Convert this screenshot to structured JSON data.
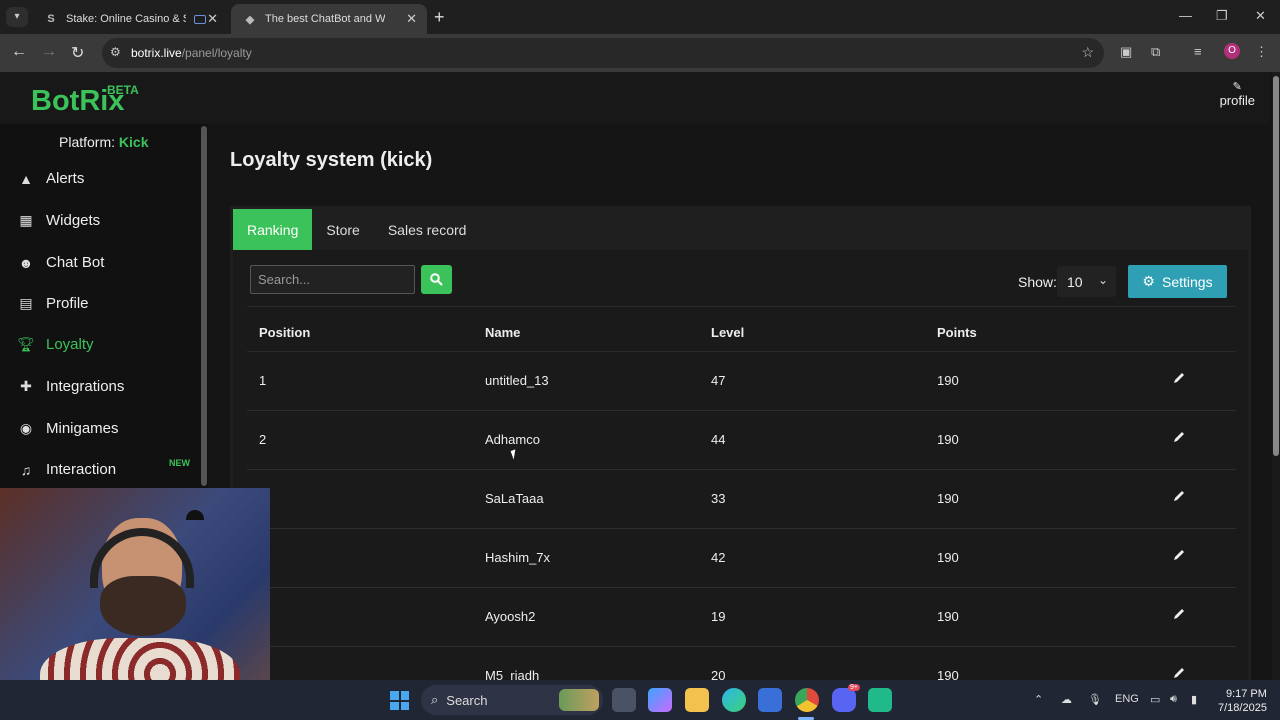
{
  "browser": {
    "tabs": [
      {
        "title": "Stake: Online Casino & Sports",
        "favicon": "S"
      },
      {
        "title": "The best ChatBot and Widgets for Kick",
        "favicon": "◆"
      }
    ],
    "url_domain": "botrix.live",
    "url_path": "/panel/loyalty",
    "profile_initial": "O"
  },
  "app": {
    "logo": "BotRix",
    "beta": "BETA",
    "profile_label": "profile",
    "platform_label": "Platform:",
    "platform_value": "Kick",
    "nav": [
      {
        "label": "Alerts",
        "icon": "warning-icon"
      },
      {
        "label": "Widgets",
        "icon": "grid-icon"
      },
      {
        "label": "Chat Bot",
        "icon": "robot-icon"
      },
      {
        "label": "Profile",
        "icon": "id-card-icon"
      },
      {
        "label": "Loyalty",
        "icon": "trophy-icon",
        "active": true
      },
      {
        "label": "Integrations",
        "icon": "puzzle-icon"
      },
      {
        "label": "Minigames",
        "icon": "gamepad-icon"
      },
      {
        "label": "Interaction",
        "icon": "music-icon"
      }
    ],
    "new_badge": "NEW"
  },
  "page": {
    "title": "Loyalty system (kick)",
    "tabs": [
      "Ranking",
      "Store",
      "Sales record"
    ],
    "active_tab": "Ranking",
    "search_placeholder": "Search...",
    "show_label": "Show:",
    "show_value": "10",
    "settings_label": "Settings",
    "columns": [
      "Position",
      "Name",
      "Level",
      "Points"
    ],
    "rows": [
      {
        "position": "1",
        "name": "untitled_13",
        "level": "47",
        "points": "190"
      },
      {
        "position": "2",
        "name": "Adhamco",
        "level": "44",
        "points": "190"
      },
      {
        "position": "",
        "name": "SaLaTaaa",
        "level": "33",
        "points": "190"
      },
      {
        "position": "",
        "name": "Hashim_7x",
        "level": "42",
        "points": "190"
      },
      {
        "position": "",
        "name": "Ayoosh2",
        "level": "19",
        "points": "190"
      },
      {
        "position": "",
        "name": "M5_riadh",
        "level": "20",
        "points": "190"
      }
    ]
  },
  "taskbar": {
    "search_label": "Search",
    "lang": "ENG",
    "time": "9:17 PM",
    "date": "7/18/2025",
    "discord_badge": "9+"
  },
  "colors": {
    "accent": "#3cc25a",
    "settings": "#2f9fb4"
  }
}
